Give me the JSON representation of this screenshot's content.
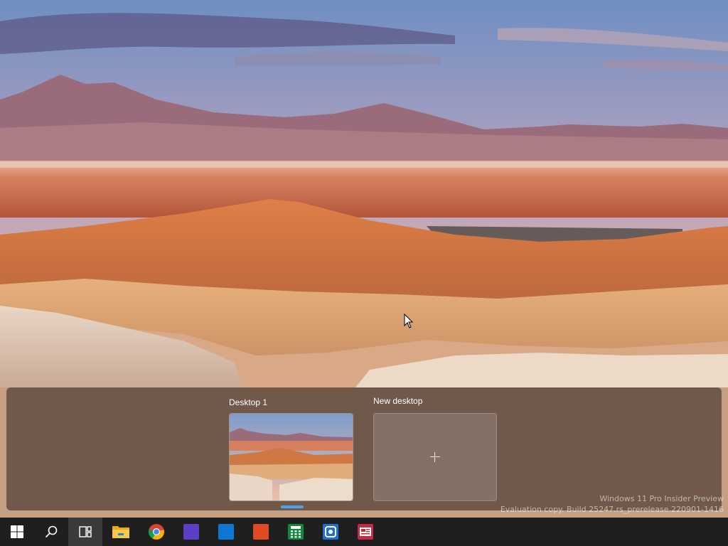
{
  "desktops": {
    "items": [
      {
        "label": "Desktop 1",
        "active": true
      },
      {
        "label": "New desktop"
      }
    ]
  },
  "watermark": {
    "line1": "Windows 11 Pro Insider Preview",
    "line2": "Evaluation copy. Build 25247.rs_prerelease.220901-1416"
  },
  "taskbar": {
    "items": [
      {
        "icon": "windows-start-icon"
      },
      {
        "icon": "search-icon"
      },
      {
        "icon": "task-view-icon",
        "active": true
      },
      {
        "icon": "file-explorer-icon",
        "color": "#f4c04a"
      },
      {
        "icon": "chrome-icon"
      },
      {
        "icon": "app-icon",
        "color": "#5b3fc4"
      },
      {
        "icon": "app-icon",
        "color": "#0a78d4"
      },
      {
        "icon": "app-icon",
        "color": "#e04b26"
      },
      {
        "icon": "calculator-icon",
        "color": "#10893e"
      },
      {
        "icon": "snipping-tool-icon",
        "color": "#1e6fd9"
      },
      {
        "icon": "news-icon",
        "color": "#c22b43"
      }
    ]
  },
  "colors": {
    "accent": "#4aa3e8",
    "taskbar": "#1f1f1f",
    "panel": "#3a2e28"
  }
}
